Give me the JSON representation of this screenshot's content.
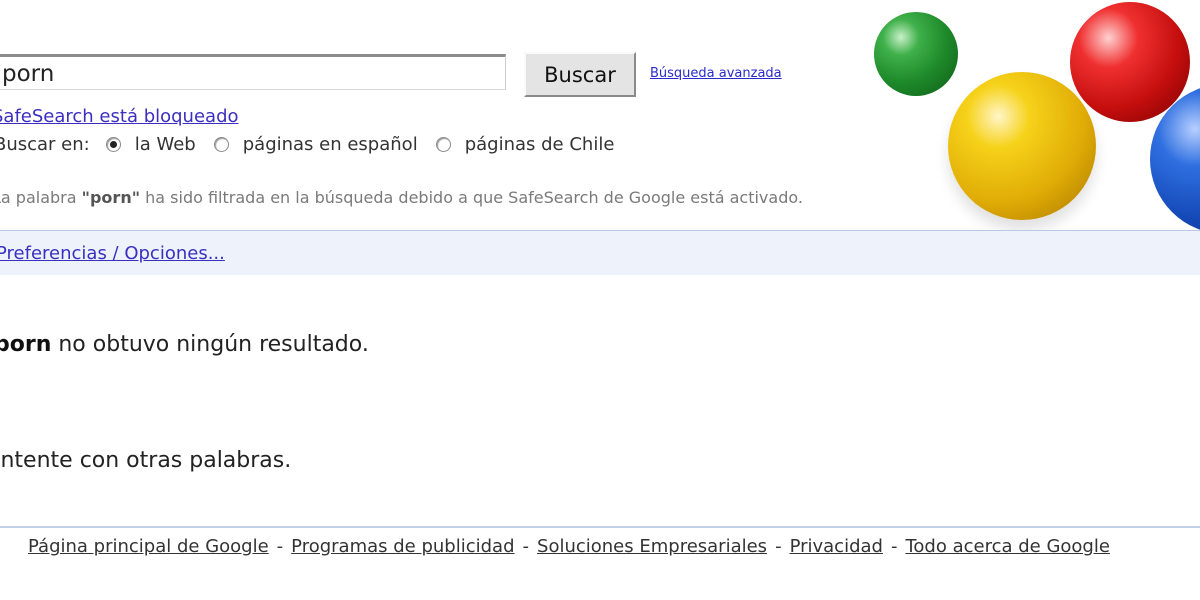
{
  "search": {
    "value": "porn",
    "button_label": "Buscar",
    "advanced_label": "Búsqueda avanzada"
  },
  "safesearch": {
    "locked_label": "SafeSearch está bloqueado"
  },
  "search_in": {
    "label": "Buscar en:",
    "options": [
      "la Web",
      "páginas en español",
      "páginas de Chile"
    ],
    "selected": "la Web"
  },
  "filter_note": {
    "prefix": "La palabra ",
    "word": "\"porn\"",
    "suffix": " ha sido filtrada en la búsqueda debido a que SafeSearch de Google está activado."
  },
  "options_link": "Preferencias / Opciones...",
  "no_results": {
    "term": "porn",
    "text": " no obtuvo ningún resultado."
  },
  "suggestion": "Intente con otras palabras.",
  "footer": {
    "links": [
      "Página principal de Google",
      "Programas de publicidad",
      "Soluciones Empresariales",
      "Privacidad",
      "Todo acerca de Google"
    ],
    "separator": "-"
  },
  "colors": {
    "link": "#3b2ec0",
    "options_bar": "#eef3fb",
    "divider": "#c3d0ea"
  },
  "icons": [
    "green-ball-icon",
    "red-ball-icon",
    "yellow-ball-icon",
    "blue-ball-icon"
  ]
}
